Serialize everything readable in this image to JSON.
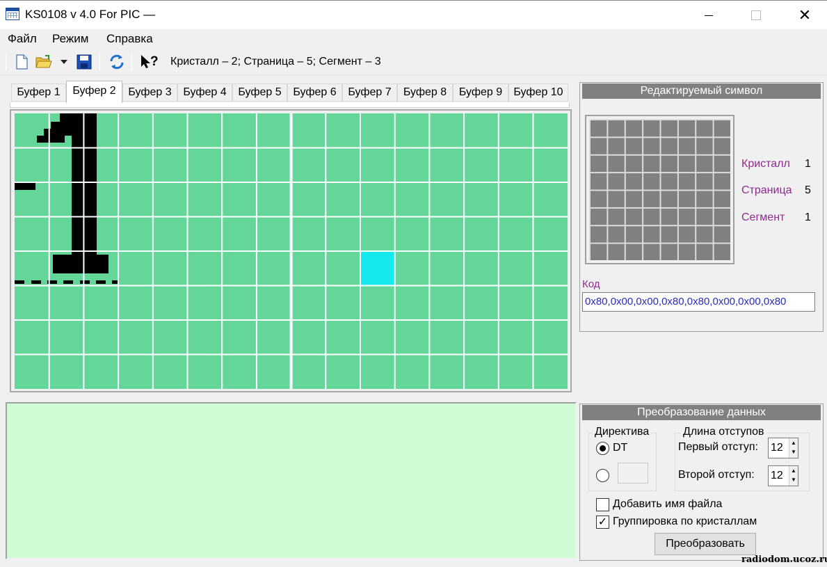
{
  "window": {
    "title": "KS0108 v 4.0 For PIC  —"
  },
  "menu": {
    "items": [
      "Файл",
      "Режим",
      "Справка"
    ]
  },
  "toolbar": {
    "icons": [
      "new-file-icon",
      "open-folder-icon",
      "dropdown-arrow-icon",
      "save-icon",
      "refresh-icon",
      "help-pointer-icon"
    ],
    "status": "Кристалл – 2;  Страница – 5;  Сегмент  – 3"
  },
  "tabs": [
    "Буфер 1",
    "Буфер 2",
    "Буфер 3",
    "Буфер 4",
    "Буфер 5",
    "Буфер 6",
    "Буфер 7",
    "Буфер 8",
    "Буфер 9",
    "Буфер 10"
  ],
  "active_tab": 1,
  "editor": {
    "cell_color": "#64d69a",
    "line_color": "#ffffff",
    "pixel_color": "#000000",
    "cursor_color": "#13e9ef",
    "glyph_digit": "1"
  },
  "symbol_panel": {
    "title": "Редактируемый символ",
    "crystal_label": "Кристалл",
    "crystal_value": "1",
    "page_label": "Страница",
    "page_value": "5",
    "segment_label": "Сегмент",
    "segment_value": "1",
    "code_label": "Код",
    "code_value": "0x80,0x00,0x00,0x80,0x80,0x00,0x00,0x80"
  },
  "conversion_panel": {
    "title": "Преобразование данных",
    "directive_title": "Директива",
    "directive_option": "DT",
    "indent_title": "Длина отступов",
    "first_indent_label": "Первый отступ:",
    "first_indent_value": "12",
    "second_indent_label": "Второй отступ:",
    "second_indent_value": "12",
    "add_filename_label": "Добавить имя файла",
    "add_filename_checked": false,
    "group_by_crystal_label": "Группировка по кристаллам",
    "group_by_crystal_checked": true,
    "convert_button": "Преобразовать"
  },
  "watermark": "radiodom.ucoz.ru"
}
